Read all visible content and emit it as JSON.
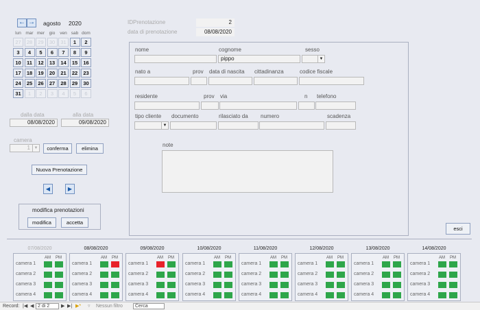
{
  "calendar": {
    "month": "agosto",
    "year": "2020",
    "weekdays": [
      "lun",
      "mar",
      "mer",
      "gio",
      "ven",
      "sab",
      "dom"
    ],
    "weeks": [
      [
        {
          "d": "27",
          "o": true
        },
        {
          "d": "28",
          "o": true
        },
        {
          "d": "29",
          "o": true
        },
        {
          "d": "30",
          "o": true
        },
        {
          "d": "31",
          "o": true
        },
        {
          "d": "1",
          "o": false
        },
        {
          "d": "2",
          "o": false
        }
      ],
      [
        {
          "d": "3",
          "o": false
        },
        {
          "d": "4",
          "o": false
        },
        {
          "d": "5",
          "o": false
        },
        {
          "d": "6",
          "o": false
        },
        {
          "d": "7",
          "o": false
        },
        {
          "d": "8",
          "o": false
        },
        {
          "d": "9",
          "o": false
        }
      ],
      [
        {
          "d": "10",
          "o": false
        },
        {
          "d": "11",
          "o": false
        },
        {
          "d": "12",
          "o": false
        },
        {
          "d": "13",
          "o": false
        },
        {
          "d": "14",
          "o": false
        },
        {
          "d": "15",
          "o": false
        },
        {
          "d": "16",
          "o": false
        }
      ],
      [
        {
          "d": "17",
          "o": false
        },
        {
          "d": "18",
          "o": false
        },
        {
          "d": "19",
          "o": false
        },
        {
          "d": "20",
          "o": false
        },
        {
          "d": "21",
          "o": false
        },
        {
          "d": "22",
          "o": false
        },
        {
          "d": "23",
          "o": false
        }
      ],
      [
        {
          "d": "24",
          "o": false
        },
        {
          "d": "25",
          "o": false
        },
        {
          "d": "26",
          "o": false
        },
        {
          "d": "27",
          "o": false
        },
        {
          "d": "28",
          "o": false
        },
        {
          "d": "29",
          "o": false
        },
        {
          "d": "30",
          "o": false
        }
      ],
      [
        {
          "d": "31",
          "o": false
        },
        {
          "d": "1",
          "o": true
        },
        {
          "d": "2",
          "o": true
        },
        {
          "d": "3",
          "o": true
        },
        {
          "d": "4",
          "o": true
        },
        {
          "d": "5",
          "o": true
        },
        {
          "d": "6",
          "o": true
        }
      ]
    ]
  },
  "range": {
    "from_label": "dalla data",
    "to_label": "alla data",
    "from_value": "08/08/2020",
    "to_value": "09/08/2020"
  },
  "camera": {
    "label": "camera",
    "value": "1"
  },
  "buttons": {
    "conferma": "conferma",
    "elimina": "elimina",
    "nuova": "Nuova Prenotazione",
    "modifica": "modifica",
    "accetta": "accetta",
    "esci": "esci"
  },
  "modifica_group_label": "modifica prenotazioni",
  "header": {
    "id_label": "IDPrenotazione",
    "id_value": "2",
    "date_label": "data di prenotazione",
    "date_value": "08/08/2020"
  },
  "form": {
    "nome": "nome",
    "cognome": "cognome",
    "cognome_value": "pippo",
    "sesso": "sesso",
    "nato_a": "nato a",
    "prov": "prov",
    "data_nascita": "data di nascita",
    "cittadinanza": "cittadinanza",
    "codice_fiscale": "codice fiscale",
    "residente": "residente",
    "prov2": "prov",
    "via": "via",
    "n": "n",
    "telefono": "telefono",
    "tipo_cliente": "tipo cliente",
    "documento": "documento",
    "rilasciato_da": "rilasciato da",
    "numero": "numero",
    "scadenza": "scadenza",
    "note": "note"
  },
  "days": [
    {
      "date": "07/08/2020",
      "dim": true,
      "busy": []
    },
    {
      "date": "08/08/2020",
      "dim": false,
      "busy": [
        "1-PM"
      ]
    },
    {
      "date": "09/08/2020",
      "dim": false,
      "busy": [
        "1-AM"
      ]
    },
    {
      "date": "10/08/2020",
      "dim": false,
      "busy": []
    },
    {
      "date": "11/08/2020",
      "dim": false,
      "busy": []
    },
    {
      "date": "12/08/2020",
      "dim": false,
      "busy": []
    },
    {
      "date": "13/08/2020",
      "dim": false,
      "busy": []
    },
    {
      "date": "14/08/2020",
      "dim": false,
      "busy": []
    }
  ],
  "cameras": [
    "camera 1",
    "camera 2",
    "camera 3",
    "camera 4"
  ],
  "am": "AM",
  "pm": "PM",
  "status": {
    "record_label": "Record:",
    "record_value": "2 di 2",
    "filter": "Nessun filtro",
    "search": "Cerca"
  },
  "colors": {
    "free": "#2ea64a",
    "busy": "#e8222a"
  }
}
